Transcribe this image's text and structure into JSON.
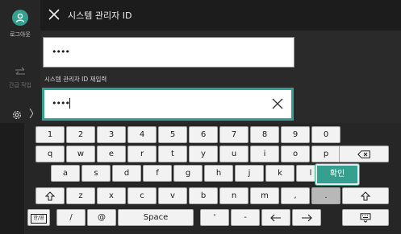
{
  "sidebar": {
    "logout_label": "로그아웃",
    "jump_label": "간급 작업"
  },
  "header": {
    "title": "시스템 관리자 ID"
  },
  "form": {
    "field1_value": "••••",
    "field2_label": "시스템 관리자 ID 재입력",
    "field2_value": "••••"
  },
  "keyboard": {
    "row1": [
      "1",
      "2",
      "3",
      "4",
      "5",
      "6",
      "7",
      "8",
      "9",
      "0"
    ],
    "row2": [
      "q",
      "w",
      "e",
      "r",
      "t",
      "y",
      "u",
      "i",
      "o",
      "p"
    ],
    "row3": [
      "a",
      "s",
      "d",
      "f",
      "g",
      "h",
      "j",
      "k",
      "l"
    ],
    "row4": [
      "z",
      "x",
      "c",
      "v",
      "b",
      "n",
      "m",
      ",",
      "."
    ],
    "lang_label": "한/영",
    "slash": "/",
    "at": "@",
    "space_label": "Space",
    "apostrophe": "'",
    "dash": "-",
    "enter_label": "확인"
  },
  "colors": {
    "accent": "#35a08f",
    "background": "#1c1c1c"
  }
}
